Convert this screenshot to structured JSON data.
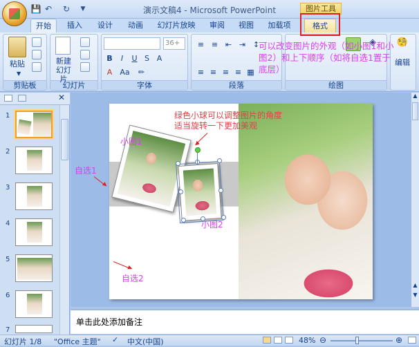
{
  "window": {
    "title": "演示文稿4 - Microsoft PowerPoint",
    "contextual_tab": "图片工具"
  },
  "quick_access": [
    "save-icon",
    "undo-icon",
    "redo-icon",
    "customize-icon"
  ],
  "tabs": [
    "开始",
    "插入",
    "设计",
    "动画",
    "幻灯片放映",
    "审阅",
    "视图",
    "加载项",
    "格式"
  ],
  "ribbon": {
    "paste_label": "粘贴",
    "new_slide_label": "新建\n幻灯片",
    "font_size": "36+",
    "edit_label": "编辑",
    "groups": [
      "剪贴板",
      "幻灯片",
      "字体",
      "段落",
      "绘图"
    ],
    "annotation": "可以改变图片的外观（如小图1和小图2）和上下顺序（如将自选1置于底层）"
  },
  "slides": [
    {
      "num": "1"
    },
    {
      "num": "2"
    },
    {
      "num": "3"
    },
    {
      "num": "4"
    },
    {
      "num": "5"
    },
    {
      "num": "6"
    },
    {
      "num": "7"
    }
  ],
  "slide_annotations": {
    "rotate_note": "绿色小球可以调整图片的角度\n适当旋转一下更加美观",
    "pic1_label": "小图1",
    "pic2_label": "小图2",
    "shape1_label": "自选1",
    "shape2_label": "自选2"
  },
  "notes_placeholder": "单击此处添加备注",
  "status": {
    "slide": "幻灯片 1/8",
    "theme": "\"Office 主题\"",
    "language": "中文(中国)",
    "zoom": "48%"
  },
  "colors": {
    "annotation_purple": "#d940ee",
    "annotation_red": "#e0404a",
    "highlight_red": "#e02020"
  }
}
